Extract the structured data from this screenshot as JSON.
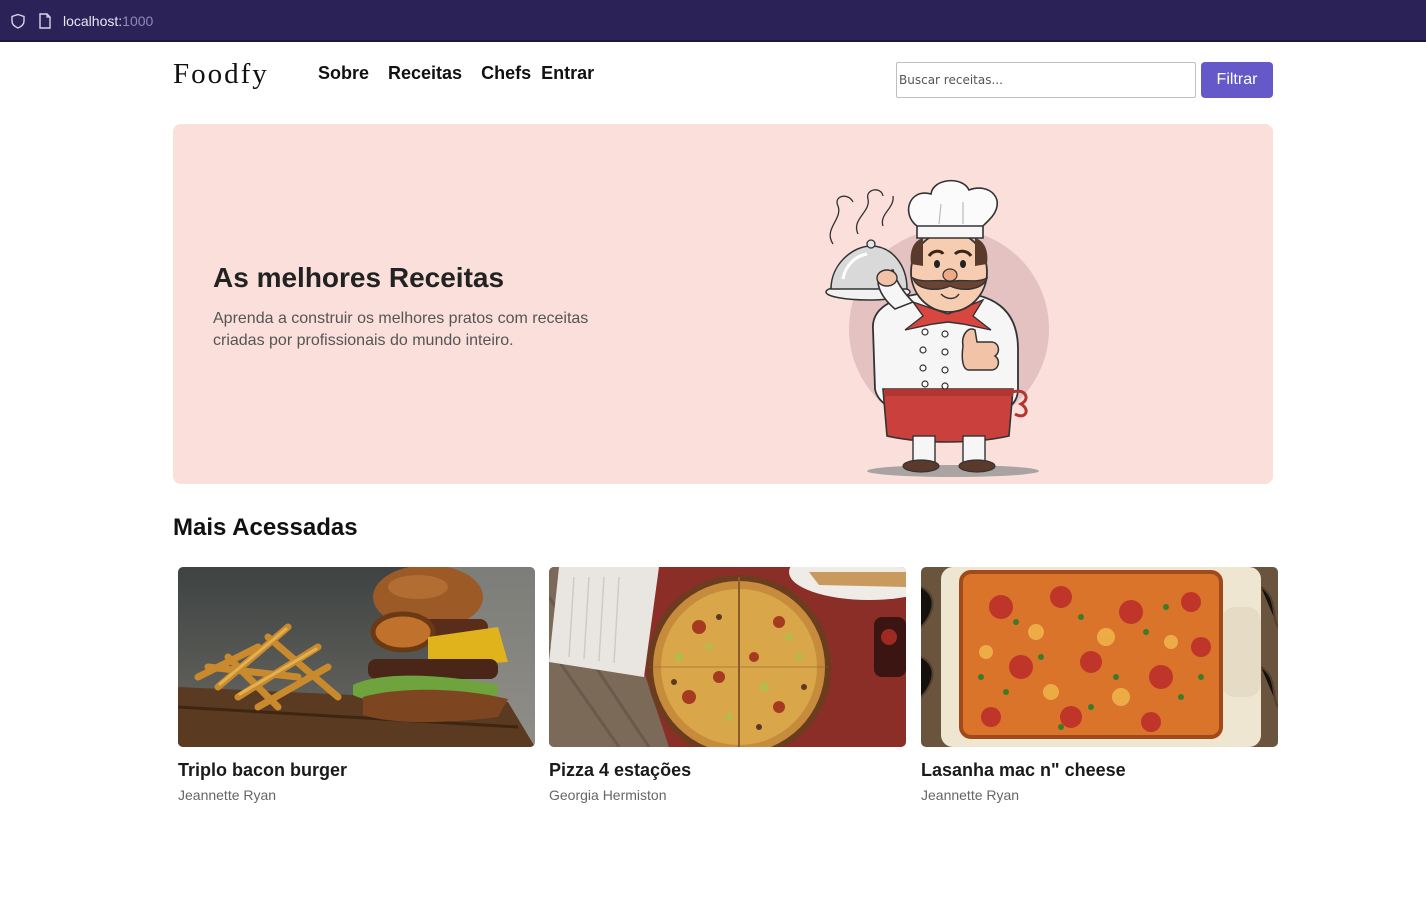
{
  "browser": {
    "url_host": "localhost:",
    "url_port": "1000"
  },
  "header": {
    "logo": "Foodfy",
    "nav": [
      "Sobre",
      "Receitas",
      "Chefs",
      "Entrar"
    ],
    "search_placeholder": "Buscar receitas...",
    "filter_label": "Filtrar"
  },
  "hero": {
    "title": "As melhores Receitas",
    "description": "Aprenda a construir os melhores pratos com receitas criadas por profissionais do mundo inteiro."
  },
  "section": {
    "title": "Mais Acessadas"
  },
  "recipes": [
    {
      "title": "Triplo bacon burger",
      "author": "Jeannette Ryan",
      "image": "burger-with-fries"
    },
    {
      "title": "Pizza 4 estações",
      "author": "Georgia Hermiston",
      "image": "pizza"
    },
    {
      "title": "Lasanha mac n\" cheese",
      "author": "Jeannette Ryan",
      "image": "lasagna-tray"
    }
  ],
  "colors": {
    "browser_bar": "#2b2258",
    "accent": "#6558c8",
    "hero_bg": "#fadfdb"
  }
}
